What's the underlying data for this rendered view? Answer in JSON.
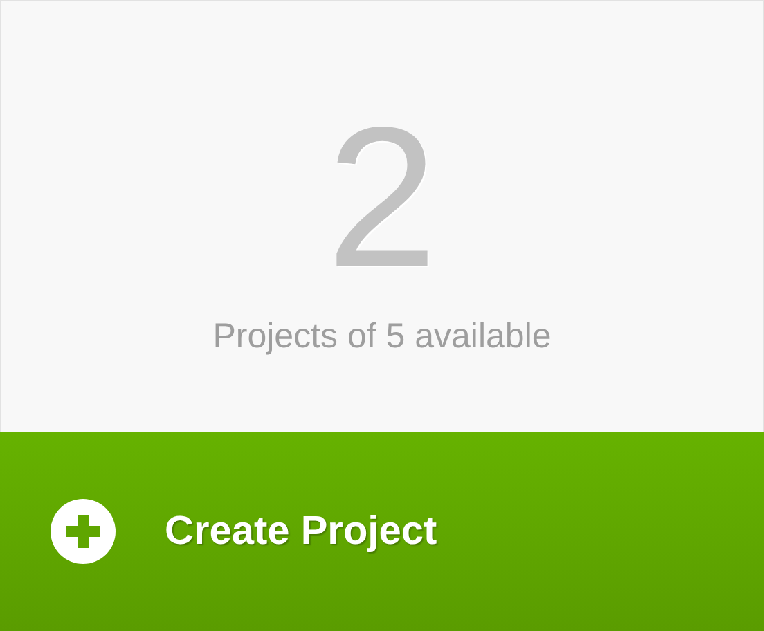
{
  "counter": {
    "value": "2",
    "caption": "Projects of 5 available"
  },
  "action": {
    "label": "Create Project"
  }
}
